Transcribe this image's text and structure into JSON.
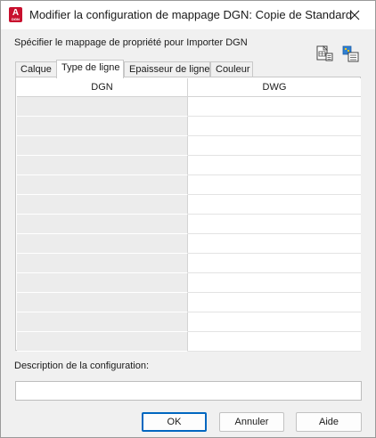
{
  "window": {
    "title": "Modifier la configuration de mappage DGN: Copie de Standard",
    "app_icon_letter": "A",
    "app_icon_sub": "DGN"
  },
  "instruction": "Spécifier le mappage de propriété pour Importer DGN",
  "tabs": [
    {
      "label": "Calque",
      "active": false
    },
    {
      "label": "Type de ligne",
      "active": true
    },
    {
      "label": "Epaisseur de ligne",
      "active": false
    },
    {
      "label": "Couleur",
      "active": false
    }
  ],
  "grid": {
    "columns": [
      "DGN",
      "DWG"
    ],
    "row_count": 13
  },
  "description": {
    "label": "Description de la configuration:",
    "value": ""
  },
  "buttons": {
    "ok": "OK",
    "cancel": "Annuler",
    "help": "Aide"
  },
  "colors": {
    "accent": "#0067c0",
    "app_red": "#c8102e",
    "dgn_cell": "#ececec"
  },
  "icons": {
    "close": "close-icon",
    "export": "export-mapping-icon",
    "import": "import-mapping-icon"
  }
}
